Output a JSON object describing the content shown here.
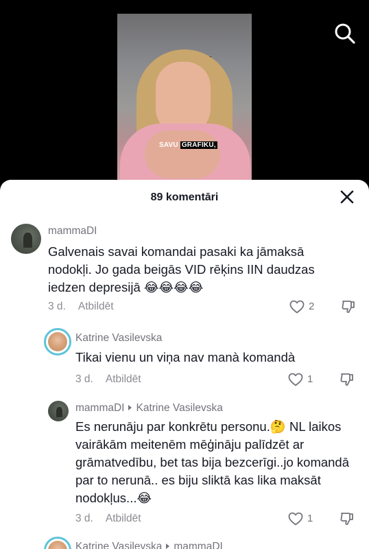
{
  "video": {
    "caption_word1": "SAVU",
    "caption_word2": "GRAFIKU,"
  },
  "search": {
    "icon": "search-icon"
  },
  "sheet": {
    "title": "89 komentāri",
    "close_icon": "close-icon"
  },
  "comments": [
    {
      "user": "mammaDI",
      "text": "Galvenais savai komandai pasaki ka jāmaksā nodokļi. Jo gada beigās VID rēķins IIN daudzas iedzen depresijā 😂😂😂😂",
      "time": "3 d.",
      "reply": "Atbildēt",
      "likes": "2"
    },
    {
      "user": "Katrine Vasilevska",
      "text": "Tikai vienu un viņa nav manà komandà",
      "time": "3 d.",
      "reply": "Atbildēt",
      "likes": "1"
    },
    {
      "user": "mammaDI",
      "reply_to": "Katrine Vasilevska",
      "text": "Es nerunāju par konkrētu personu.🤔 NL laikos vairākām meitenēm mēģināju palīdzēt ar grāmatvedību, bet tas bija bezcerīgi..jo komandā par to nerunā.. es biju sliktā kas lika maksāt nodokļus...😂",
      "time": "3 d.",
      "reply": "Atbildēt",
      "likes": "1"
    },
    {
      "user": "Katrine Vasilevska",
      "reply_to": "mammaDI"
    }
  ]
}
